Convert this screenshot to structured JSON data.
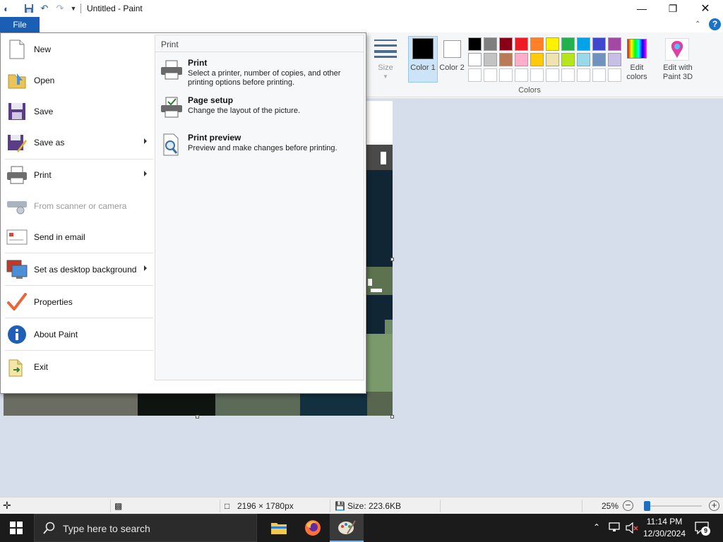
{
  "window": {
    "title": "Untitled - Paint"
  },
  "ribbon": {
    "file_tab": "File",
    "size_label": "Size",
    "color1_label": "Color 1",
    "color2_label": "Color 2",
    "edit_colors_label": "Edit colors",
    "paint3d_label": "Edit with Paint 3D",
    "colors_group_label": "Colors",
    "palette_row1": [
      "#000000",
      "#7f7f7f",
      "#880015",
      "#ed1c24",
      "#ff7f27",
      "#fff200",
      "#22b14c",
      "#00a2e8",
      "#3f48cc",
      "#a349a4"
    ],
    "palette_row2": [
      "#ffffff",
      "#c3c3c3",
      "#b97a57",
      "#ffaec9",
      "#ffc90e",
      "#efe4b0",
      "#b5e61d",
      "#99d9ea",
      "#7092be",
      "#c8bfe7"
    ]
  },
  "file_menu": {
    "items": [
      {
        "label": "New",
        "icon": "new-document-icon"
      },
      {
        "label": "Open",
        "icon": "open-folder-icon"
      },
      {
        "label": "Save",
        "icon": "save-disk-icon"
      },
      {
        "label": "Save as",
        "icon": "save-as-icon"
      },
      {
        "label": "Print",
        "icon": "printer-icon"
      },
      {
        "label": "From scanner or camera",
        "icon": "scanner-icon"
      },
      {
        "label": "Send in email",
        "icon": "email-icon"
      },
      {
        "label": "Set as desktop background",
        "icon": "desktop-icon"
      },
      {
        "label": "Properties",
        "icon": "checkmark-icon"
      },
      {
        "label": "About Paint",
        "icon": "info-icon"
      },
      {
        "label": "Exit",
        "icon": "exit-icon"
      }
    ],
    "submenu": {
      "header": "Print",
      "items": [
        {
          "title": "Print",
          "description": "Select a printer, number of copies, and other printing options before printing."
        },
        {
          "title": "Page setup",
          "description": "Change the layout of the picture."
        },
        {
          "title": "Print preview",
          "description": "Preview and make changes before printing."
        }
      ]
    }
  },
  "statusbar": {
    "dimensions": "2196 × 1780px",
    "size": "Size: 223.6KB",
    "zoom": "25%"
  },
  "taskbar": {
    "search_placeholder": "Type here to search",
    "time": "11:14 PM",
    "date": "12/30/2024",
    "notification_count": "9"
  }
}
